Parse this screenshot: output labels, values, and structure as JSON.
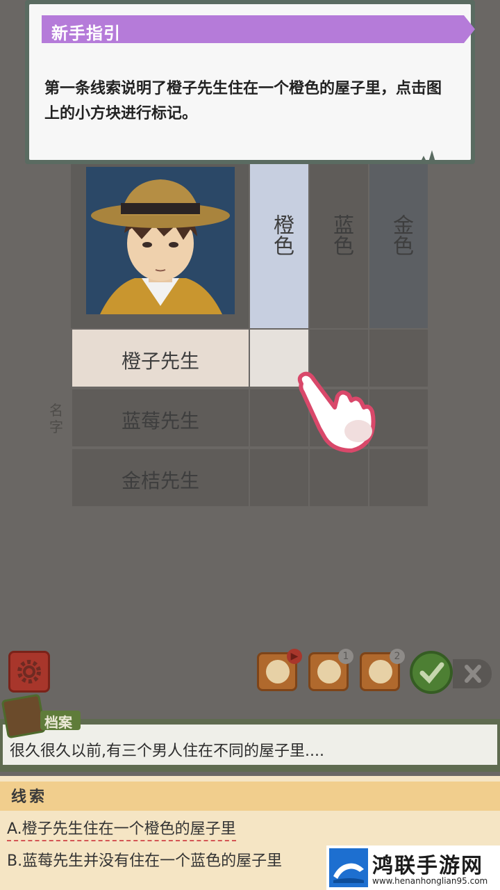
{
  "guide": {
    "title": "新手指引",
    "text": "第一条线索说明了橙子先生住在一个橙色的屋子里，点击图上的小方块进行标记。"
  },
  "grid": {
    "columns": [
      "橙色",
      "蓝色",
      "金色"
    ],
    "rows": [
      "橙子先生",
      "蓝莓先生",
      "金桔先生"
    ],
    "side_label": "名字"
  },
  "tools": [
    {
      "icon": "magnifier-video-icon",
      "badge": ""
    },
    {
      "icon": "refresh-icon",
      "badge": "1"
    },
    {
      "icon": "magnifier-clock-icon",
      "badge": "2"
    }
  ],
  "archive": {
    "tag": "档案",
    "text": "很久很久以前,有三个男人住在不同的屋子里...."
  },
  "clues": {
    "title": "线索",
    "items": [
      "A.橙子先生住在一个橙色的屋子里",
      "B.蓝莓先生并没有住在一个蓝色的屋子里"
    ]
  },
  "watermark": {
    "title": "鸿联手游网",
    "url": "www.henanhonglian95.com"
  },
  "colors": {
    "guide_header": "#b57bd9",
    "highlight_col": "#c7cfe0",
    "highlight_row": "#e7dcd2",
    "accent_green": "#5f7c3a",
    "clue_bg": "#f5e5c4"
  }
}
